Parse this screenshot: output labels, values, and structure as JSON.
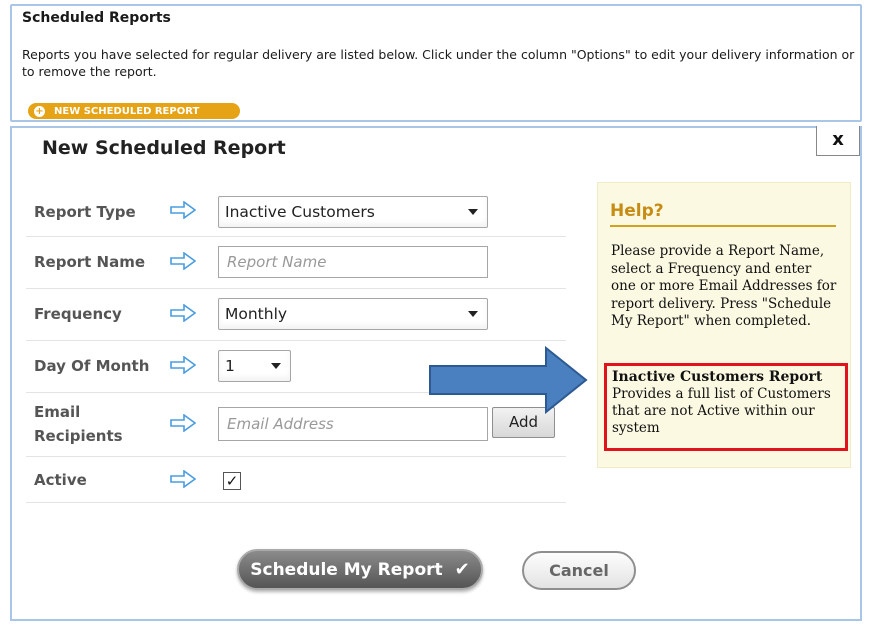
{
  "scheduled": {
    "title": "Scheduled Reports",
    "description": "Reports you have selected for regular delivery are listed below. Click under the column \"Options\" to edit your delivery information or to remove the report.",
    "new_button": "NEW SCHEDULED REPORT"
  },
  "modal": {
    "title": "New Scheduled Report",
    "close": "x",
    "fields": {
      "report_type": {
        "label": "Report Type",
        "value": "Inactive Customers"
      },
      "report_name": {
        "label": "Report Name",
        "placeholder": "Report Name"
      },
      "frequency": {
        "label": "Frequency",
        "value": "Monthly"
      },
      "day_of_month": {
        "label": "Day Of Month",
        "value": "1"
      },
      "email": {
        "label_line1": "Email",
        "label_line2": "Recipients",
        "placeholder": "Email Address",
        "add_label": "Add"
      },
      "active": {
        "label": "Active",
        "checked": true,
        "mark": "✓"
      }
    },
    "help": {
      "title": "Help?",
      "text": "Please provide a Report Name, select a Frequency and enter one or more Email Addresses for report delivery. Press \"Schedule My Report\" when completed.",
      "report_title": "Inactive Customers Report",
      "report_text": "Provides a full list of Customers that are not Active within our system"
    },
    "buttons": {
      "schedule": "Schedule My Report",
      "schedule_icon": "✔",
      "cancel": "Cancel"
    }
  },
  "colors": {
    "accent_orange": "#e6a316",
    "border_blue": "#a9c6e6",
    "arrow_blue": "#4a86c6",
    "highlight_red": "#e0141c",
    "help_bg": "#fbf9e2"
  },
  "icons": {
    "field_arrow": "arrow-right-outline-icon",
    "big_arrow": "big-blue-arrow-icon",
    "plus": "plus-circle-icon",
    "check": "checkmark-icon",
    "caret": "chevron-down-icon"
  }
}
